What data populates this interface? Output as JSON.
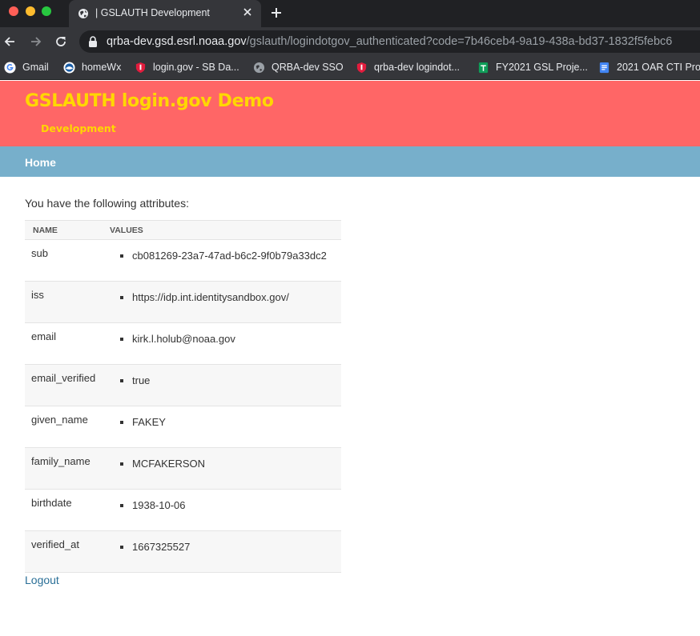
{
  "browser": {
    "tab": {
      "title": "| GSLAUTH Development"
    },
    "url": {
      "host": "qrba-dev.gsd.esrl.noaa.gov",
      "path": "/gslauth/logindotgov_authenticated?code=7b46ceb4-9a19-438a-bd37-1832f5febc6"
    },
    "bookmarks": [
      {
        "label": "Gmail",
        "icon": "google-icon"
      },
      {
        "label": "homeWx",
        "icon": "noaa-icon"
      },
      {
        "label": "login.gov - SB Da...",
        "icon": "shield-icon"
      },
      {
        "label": "QRBA-dev SSO",
        "icon": "globe-icon"
      },
      {
        "label": "qrba-dev logindot...",
        "icon": "shield-icon"
      },
      {
        "label": "FY2021 GSL Proje...",
        "icon": "sheets-icon"
      },
      {
        "label": "2021 OAR CTI Pro...",
        "icon": "docs-icon"
      }
    ]
  },
  "header": {
    "title": "GSLAUTH login.gov Demo",
    "subtitle": "Development"
  },
  "nav": {
    "home": "Home"
  },
  "main": {
    "intro": "You have the following attributes:",
    "columns": {
      "name": "NAME",
      "values": "VALUES"
    },
    "attributes": [
      {
        "name": "sub",
        "value": "cb081269-23a7-47ad-b6c2-9f0b79a33dc2"
      },
      {
        "name": "iss",
        "value": "https://idp.int.identitysandbox.gov/"
      },
      {
        "name": "email",
        "value": "kirk.l.holub@noaa.gov"
      },
      {
        "name": "email_verified",
        "value": "true"
      },
      {
        "name": "given_name",
        "value": "FAKEY"
      },
      {
        "name": "family_name",
        "value": "MCFAKERSON"
      },
      {
        "name": "birthdate",
        "value": "1938-10-06"
      },
      {
        "name": "verified_at",
        "value": "1667325527"
      }
    ],
    "logout": "Logout"
  },
  "colors": {
    "header_bg": "#ff6666",
    "header_text": "#ffd700",
    "nav_bg": "#77afcb",
    "link": "#2a6f97"
  }
}
